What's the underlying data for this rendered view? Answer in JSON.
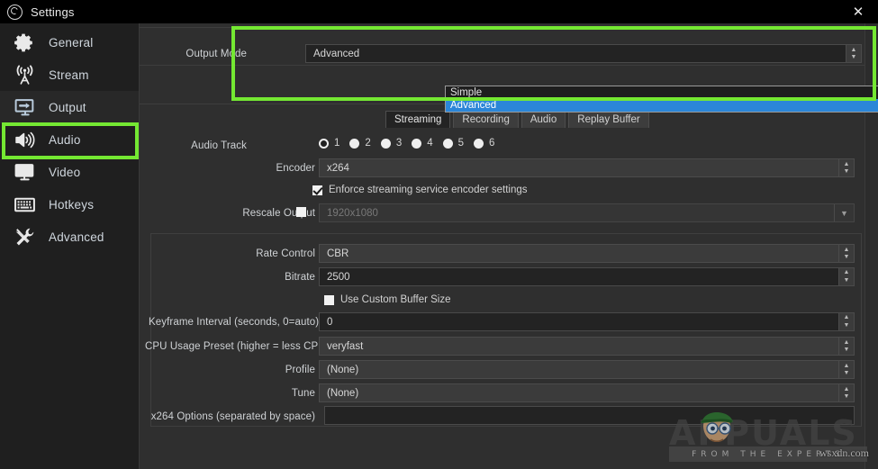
{
  "window": {
    "title": "Settings",
    "logo_icon": "obs-logo-icon",
    "close_icon": "close-icon"
  },
  "sidebar": {
    "items": [
      {
        "id": "general",
        "label": "General",
        "icon": "gear-icon",
        "selected": false
      },
      {
        "id": "stream",
        "label": "Stream",
        "icon": "broadcast-icon",
        "selected": false
      },
      {
        "id": "output",
        "label": "Output",
        "icon": "monitor-arrow-icon",
        "selected": true
      },
      {
        "id": "audio",
        "label": "Audio",
        "icon": "speaker-icon",
        "selected": false
      },
      {
        "id": "video",
        "label": "Video",
        "icon": "monitor-icon",
        "selected": false
      },
      {
        "id": "hotkeys",
        "label": "Hotkeys",
        "icon": "keyboard-icon",
        "selected": false
      },
      {
        "id": "advanced",
        "label": "Advanced",
        "icon": "tools-icon",
        "selected": false
      }
    ]
  },
  "main": {
    "output_mode": {
      "label": "Output Mode",
      "value": "Advanced",
      "expanded": true,
      "options": [
        {
          "label": "Simple",
          "selected": false
        },
        {
          "label": "Advanced",
          "selected": true
        }
      ]
    },
    "tabs": [
      {
        "label": "Streaming",
        "active": true
      },
      {
        "label": "Recording",
        "active": false
      },
      {
        "label": "Audio",
        "active": false
      },
      {
        "label": "Replay Buffer",
        "active": false
      }
    ],
    "audio_track": {
      "label": "Audio Track",
      "options": [
        "1",
        "2",
        "3",
        "4",
        "5",
        "6"
      ],
      "selected": "1"
    },
    "encoder": {
      "label": "Encoder",
      "value": "x264"
    },
    "enforce": {
      "label": "Enforce streaming service encoder settings",
      "checked": true
    },
    "rescale_output": {
      "label": "Rescale Output",
      "checked": false,
      "value": "1920x1080",
      "disabled": true
    },
    "rate_control": {
      "label": "Rate Control",
      "value": "CBR"
    },
    "bitrate": {
      "label": "Bitrate",
      "value": "2500"
    },
    "custom_buffer": {
      "label": "Use Custom Buffer Size",
      "checked": false
    },
    "keyframe": {
      "label": "Keyframe Interval (seconds, 0=auto)",
      "value": "0"
    },
    "cpu_preset": {
      "label": "CPU Usage Preset (higher = less CPU)",
      "value": "veryfast"
    },
    "profile": {
      "label": "Profile",
      "value": "(None)"
    },
    "tune": {
      "label": "Tune",
      "value": "(None)"
    },
    "x264_options": {
      "label": "x264 Options (separated by space)",
      "value": ""
    }
  },
  "highlights": {
    "color": "#74e832",
    "regions": [
      {
        "name": "sidebar-output-highlight"
      },
      {
        "name": "output-mode-highlight"
      }
    ]
  },
  "watermark": {
    "word": "APPUALS",
    "subtitle": "FROM THE EXPERTS",
    "url": "wsxdn.com"
  }
}
